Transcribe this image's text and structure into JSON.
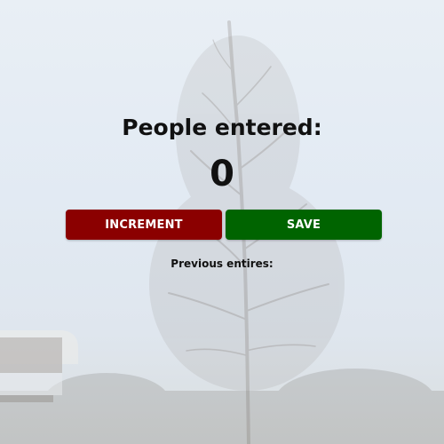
{
  "header": {
    "title": "People entered:"
  },
  "counter": {
    "value": "0"
  },
  "actions": {
    "increment_label": "INCREMENT",
    "save_label": "SAVE",
    "increment_color": "#8b0000",
    "save_color": "#006400"
  },
  "history": {
    "label": "Previous entires:"
  }
}
